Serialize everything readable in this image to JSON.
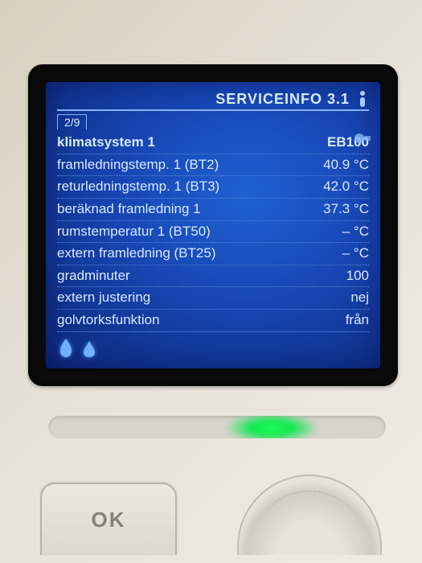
{
  "header": {
    "title": "SERVICEINFO 3.1",
    "page_indicator": "2/9"
  },
  "system": {
    "label": "klimatsystem 1",
    "id": "EB100"
  },
  "rows": [
    {
      "label": "framledningstemp. 1 (BT2)",
      "value": "40.9 °C"
    },
    {
      "label": "returledningstemp. 1 (BT3)",
      "value": "42.0 °C"
    },
    {
      "label": "beräknad framledning 1",
      "value": "37.3 °C"
    },
    {
      "label": "rumstemperatur 1 (BT50)",
      "value": "– °C"
    },
    {
      "label": "extern framledning (BT25)",
      "value": "– °C"
    },
    {
      "label": "gradminuter",
      "value": "100"
    },
    {
      "label": "extern justering",
      "value": "nej"
    },
    {
      "label": "golvtorksfunktion",
      "value": "från"
    }
  ],
  "buttons": {
    "ok": "OK"
  }
}
